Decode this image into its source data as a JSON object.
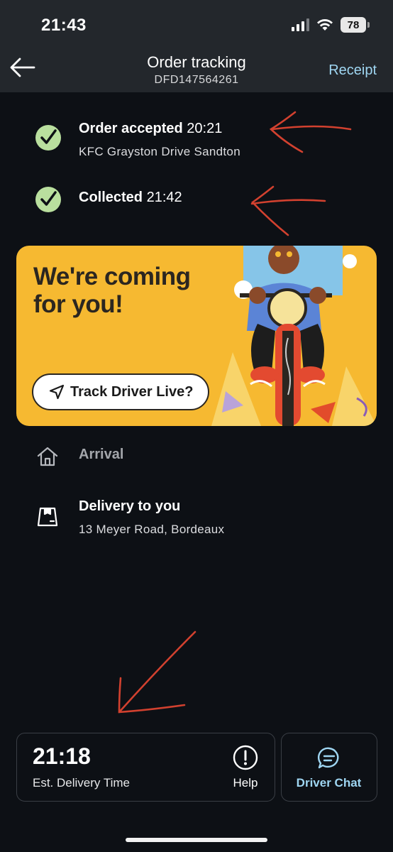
{
  "status_bar": {
    "time": "21:43",
    "battery": "78"
  },
  "header": {
    "title": "Order tracking",
    "order_id": "DFD147564261",
    "receipt_label": "Receipt"
  },
  "timeline": [
    {
      "title": "Order accepted",
      "time": "20:21",
      "subtitle": "KFC Grayston Drive Sandton",
      "icon": "check-circle-icon",
      "done": true
    },
    {
      "title": "Collected",
      "time": "21:42",
      "icon": "check-circle-icon",
      "done": true
    },
    {
      "title": "Arrival",
      "icon": "home-icon",
      "done": false
    },
    {
      "title": "Delivery to you",
      "subtitle": "13 Meyer Road, Bordeaux",
      "icon": "package-icon",
      "done": false
    }
  ],
  "promo": {
    "headline": "We're coming for you!",
    "button_label": "Track Driver Live?",
    "button_icon": "navigation-arrow-icon"
  },
  "footer": {
    "eta_time": "21:18",
    "eta_label": "Est. Delivery Time",
    "help_label": "Help",
    "chat_label": "Driver Chat"
  },
  "colors": {
    "background": "#0d1015",
    "header": "#23272c",
    "check": "#b9df9e",
    "accent": "#9fd6f2",
    "promo": "#f6b931",
    "annotation": "#d2412f"
  }
}
